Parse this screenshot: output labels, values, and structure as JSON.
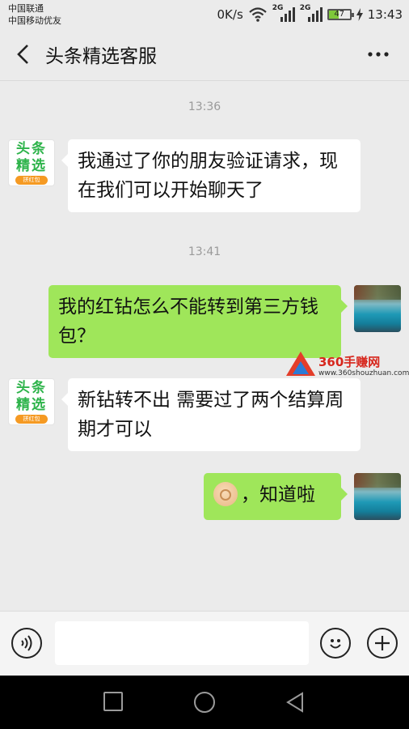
{
  "status_bar": {
    "carrier1": "中国联通",
    "carrier2": "中国移动优友",
    "speed": "0K/s",
    "signal1_label": "2G",
    "signal2_label": "2G",
    "battery_level": 47,
    "battery_text": "47",
    "time": "13:43"
  },
  "header": {
    "title": "头条精选客服"
  },
  "contact_logo": {
    "line1": "头条",
    "line2": "精选",
    "tagline": "拼红包"
  },
  "messages": [
    {
      "time": "13:36"
    },
    {
      "sender": "contact",
      "text": "我通过了你的朋友验证请求，现在我们可以开始聊天了"
    },
    {
      "time": "13:41"
    },
    {
      "sender": "me",
      "text": "我的红钻怎么不能转到第三方钱包？"
    },
    {
      "sender": "contact",
      "text": "新钻转不出  需要过了两个结算周期才可以"
    },
    {
      "sender": "me",
      "emoji": "ok-hand-emoji",
      "text": "，知道啦"
    }
  ],
  "watermark": {
    "title": "360手赚网",
    "url": "www.360shouzhuan.com"
  },
  "input": {
    "value": "",
    "placeholder": ""
  },
  "icons": {
    "back": "back-arrow-icon",
    "more": "more-icon",
    "voice": "voice-icon",
    "emoji": "emoji-icon",
    "plus": "plus-icon"
  },
  "colors": {
    "background": "#ebebeb",
    "my_bubble": "#9fe65a",
    "their_bubble": "#ffffff",
    "brand_green": "#2db34a"
  }
}
